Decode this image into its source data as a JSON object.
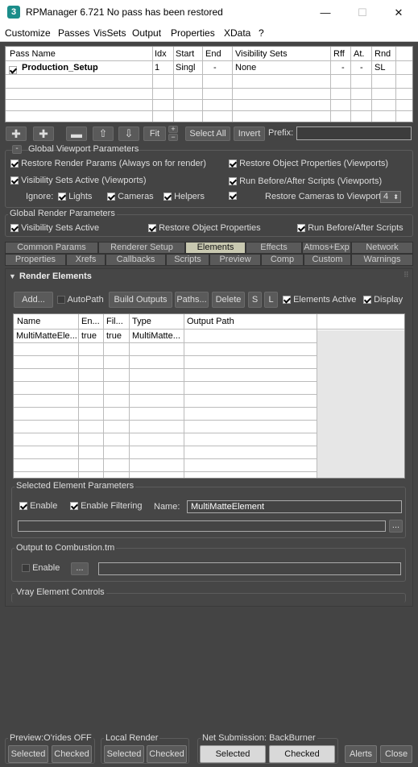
{
  "window": {
    "title": "RPManager 6.721   No pass has been restored",
    "app_icon": "3",
    "minimize": "—",
    "maximize": "☐",
    "close": "✕"
  },
  "menu": [
    "Customize",
    "Passes",
    "VisSets",
    "Output",
    "Properties",
    "XData",
    "?"
  ],
  "pass_table": {
    "headers": [
      "Pass Name",
      "Idx",
      "Start",
      "End",
      "Visibility Sets",
      "Rff",
      "At.",
      "Rnd"
    ],
    "rows": [
      [
        "Production_Setup",
        "1",
        "Singl",
        "-",
        "None",
        "-",
        "-",
        "SL"
      ]
    ]
  },
  "toolbar": {
    "fit": "Fit",
    "select_all": "Select All",
    "invert": "Invert",
    "prefix_label": "Prefix:",
    "prefix_value": ""
  },
  "global_viewport": {
    "title": "Global Viewport Parameters",
    "restore_render_params": "Restore Render Params (Always on for render)",
    "restore_object_props": "Restore Object Properties (Viewports)",
    "visibility_sets_active": "Visibility Sets Active (Viewports)",
    "run_scripts": "Run Before/After Scripts (Viewports)",
    "ignore": "Ignore:",
    "lights": "Lights",
    "cameras": "Cameras",
    "helpers": "Helpers",
    "restore_cameras": "Restore Cameras to Viewport:",
    "camera_viewport": "4"
  },
  "global_render": {
    "title": "Global Render Parameters",
    "visibility_sets_active": "Visibility Sets Active",
    "restore_object_props": "Restore Object Properties",
    "run_scripts": "Run Before/After Scripts"
  },
  "tabs_row1": [
    "Common Params",
    "Renderer Setup",
    "Elements",
    "Effects",
    "Atmos+Exp",
    "Network"
  ],
  "tabs_row2": [
    "Properties",
    "Xrefs",
    "Callbacks",
    "Scripts",
    "Preview",
    "Comp",
    "Custom",
    "Warnings"
  ],
  "render_elements": {
    "title": "Render Elements",
    "add": "Add...",
    "autopath": "AutoPath",
    "build_outputs": "Build Outputs",
    "paths": "Paths...",
    "delete": "Delete",
    "s": "S",
    "l": "L",
    "elements_active": "Elements Active",
    "display": "Display",
    "headers": [
      "Name",
      "En...",
      "Fil...",
      "Type",
      "Output Path"
    ],
    "rows": [
      [
        "MultiMatteEle...",
        "true",
        "true",
        "MultiMatte...",
        ""
      ]
    ]
  },
  "selected_element": {
    "title": "Selected Element Parameters",
    "enable": "Enable",
    "enable_filtering": "Enable Filtering",
    "name_label": "Name:",
    "name_value": "MultiMatteElement",
    "browse": "..."
  },
  "combustion": {
    "title": "Output to Combustion.tm",
    "enable": "Enable",
    "browse": "..."
  },
  "vray": {
    "title": "Vray Element Controls"
  },
  "bottom": {
    "preview_title": "Preview:O'rides OFF",
    "local_title": "Local Render",
    "net_title": "Net Submission: BackBurner",
    "selected": "Selected",
    "checked": "Checked",
    "alerts": "Alerts",
    "close": "Close"
  }
}
